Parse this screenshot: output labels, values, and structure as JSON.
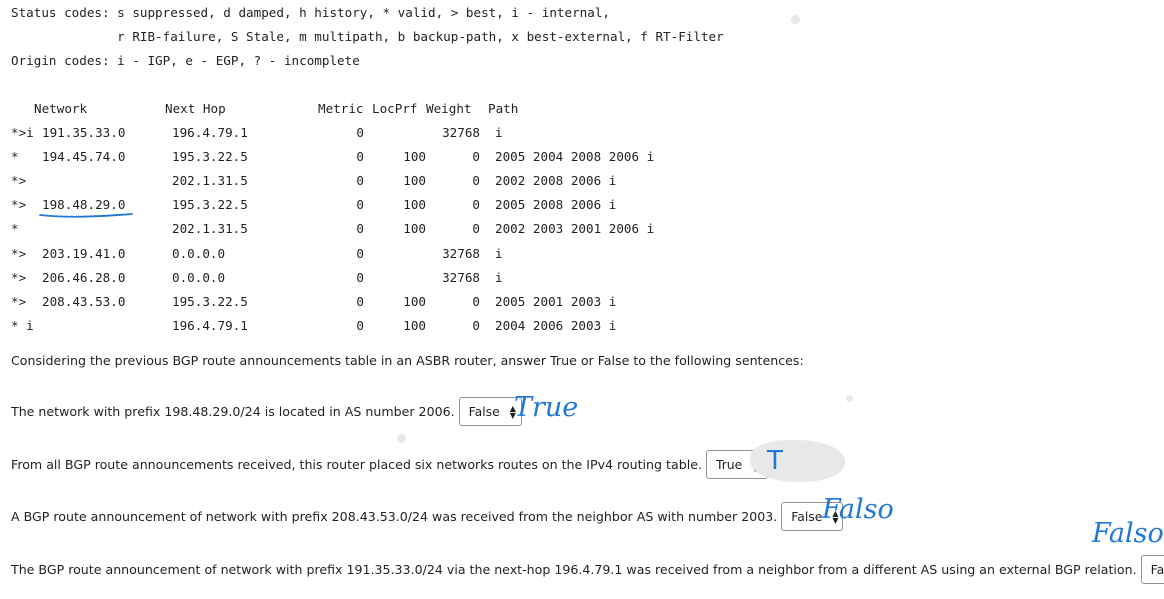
{
  "legend": {
    "status_line1": "Status codes: s suppressed, d damped, h history, * valid, > best, i - internal,",
    "status_line2": "              r RIB-failure, S Stale, m multipath, b backup-path, x best-external, f RT-Filter",
    "origin_line": "Origin codes: i - IGP, e - EGP, ? - incomplete"
  },
  "table": {
    "headers": {
      "network": "Network",
      "next_hop": "Next Hop",
      "metric": "Metric",
      "locprf": "LocPrf",
      "weight": "Weight",
      "path": "Path"
    },
    "rows": [
      {
        "status": "*>i",
        "network": "191.35.33.0",
        "next_hop": "196.4.79.1",
        "metric": "0",
        "locprf": "",
        "weight": "32768",
        "path": "i"
      },
      {
        "status": "*",
        "network": "194.45.74.0",
        "next_hop": "195.3.22.5",
        "metric": "0",
        "locprf": "100",
        "weight": "0",
        "path": "2005 2004 2008 2006 i"
      },
      {
        "status": "*>",
        "network": "",
        "next_hop": "202.1.31.5",
        "metric": "0",
        "locprf": "100",
        "weight": "0",
        "path": "2002 2008 2006 i"
      },
      {
        "status": "*>",
        "network": "198.48.29.0",
        "next_hop": "195.3.22.5",
        "metric": "0",
        "locprf": "100",
        "weight": "0",
        "path": "2005 2008 2006 i"
      },
      {
        "status": "*",
        "network": "",
        "next_hop": "202.1.31.5",
        "metric": "0",
        "locprf": "100",
        "weight": "0",
        "path": "2002 2003 2001 2006 i"
      },
      {
        "status": "*>",
        "network": "203.19.41.0",
        "next_hop": "0.0.0.0",
        "metric": "0",
        "locprf": "",
        "weight": "32768",
        "path": "i"
      },
      {
        "status": "*>",
        "network": "206.46.28.0",
        "next_hop": "0.0.0.0",
        "metric": "0",
        "locprf": "",
        "weight": "32768",
        "path": "i"
      },
      {
        "status": "*>",
        "network": "208.43.53.0",
        "next_hop": "195.3.22.5",
        "metric": "0",
        "locprf": "100",
        "weight": "0",
        "path": "2005 2001 2003 i"
      },
      {
        "status": "* i",
        "network": "",
        "next_hop": "196.4.79.1",
        "metric": "0",
        "locprf": "100",
        "weight": "0",
        "path": "2004 2006 2003 i"
      }
    ]
  },
  "intro": "Considering the previous BGP route announcements table in an ASBR router, answer True or False to the following sentences:",
  "questions": [
    {
      "text": "The network with prefix 198.48.29.0/24 is located in AS number 2006.",
      "selected": "False",
      "annotation": "True"
    },
    {
      "text": "From all BGP route announcements received, this router placed six networks routes on the IPv4 routing table.",
      "selected": "True",
      "annotation": "T"
    },
    {
      "text": "A BGP route announcement of network with prefix 208.43.53.0/24 was received from the neighbor AS with number 2003.",
      "selected": "False",
      "annotation": "Falso"
    },
    {
      "text": "The BGP route announcement of network with prefix 191.35.33.0/24 via the next-hop 196.4.79.1 was received from a neighbor from a different AS using an external BGP relation.",
      "selected": "False",
      "annotation": "Falso"
    }
  ],
  "colors": {
    "ink": "#1f77d8",
    "text": "#1d2125",
    "border": "#8f959e"
  }
}
